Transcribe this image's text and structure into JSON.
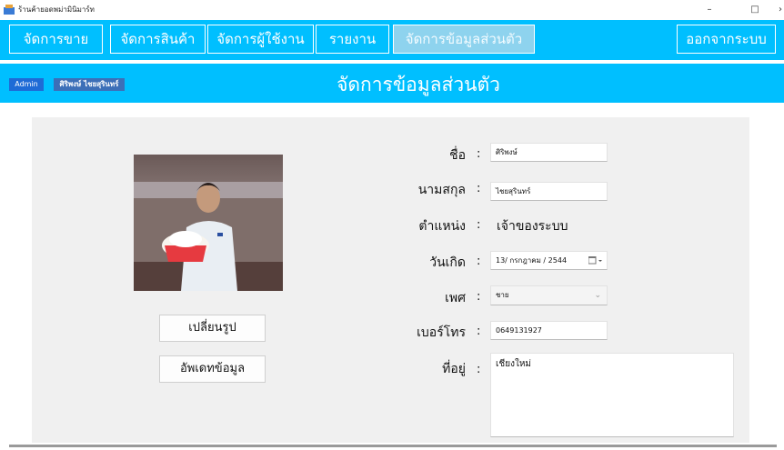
{
  "window": {
    "title": "ร้านค้ายอดพม่ามินิมาร์ท",
    "minimize": "–",
    "maximize": "□",
    "close": "›"
  },
  "menu": {
    "items": [
      {
        "label": "จัดการขาย"
      },
      {
        "label": "จัดการสินค้า"
      },
      {
        "label": "จัดการผู้ใช้งาน"
      },
      {
        "label": "รายงาน"
      },
      {
        "label": "จัดการข้อมูลส่วนตัว"
      }
    ],
    "logout": "ออกจากระบบ"
  },
  "header": {
    "role": "Admin",
    "user": "ศิริพงษ์ ไชยสุรินทร์",
    "title": "จัดการข้อมูลส่วนตัว"
  },
  "profile": {
    "change_photo": "เปลี่ยนรูป",
    "update": "อัพเดทข้อมูล",
    "colon": ":",
    "fields": {
      "first_name": {
        "label": "ชื่อ",
        "value": "ศิริพงษ์"
      },
      "last_name": {
        "label": "นามสกุล",
        "value": "ไชยสุรินทร์"
      },
      "position": {
        "label": "ตำแหน่ง",
        "value": "เจ้าของระบบ"
      },
      "birthdate": {
        "label": "วันเกิด",
        "value": "13/ กรกฎาคม / 2544"
      },
      "gender": {
        "label": "เพศ",
        "value": "ชาย"
      },
      "phone": {
        "label": "เบอร์โทร",
        "value": "0649131927"
      },
      "address": {
        "label": "ที่อยู่",
        "value": "เชียงใหม่"
      }
    }
  }
}
